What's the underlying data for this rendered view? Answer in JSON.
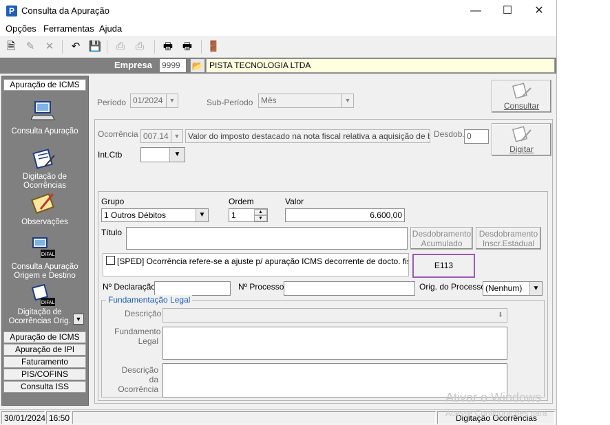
{
  "window": {
    "title": "Consulta da Apuração",
    "app_icon": "P"
  },
  "menu": [
    "Opções",
    "Ferramentas",
    "Ajuda"
  ],
  "empresa": {
    "label": "Empresa",
    "code": "9999",
    "name": "PISTA TECNOLOGIA LTDA"
  },
  "sidebar": {
    "active_tab": "Apuração de ICMS",
    "items": [
      {
        "label": "Consulta Apuração",
        "icon": "computer-icon"
      },
      {
        "label": "Digitação de Ocorrências",
        "icon": "notepad-icon"
      },
      {
        "label": "Observações",
        "icon": "notepad-pencil-icon"
      },
      {
        "label": "Consulta Apuração Origem e Destino",
        "icon": "difal-computer-icon"
      },
      {
        "label": "Digitação de Ocorrências Orig. De",
        "icon": "difal-notepad-icon"
      }
    ],
    "tabs": [
      "Apuração de ICMS ST",
      "Apuração de IPI",
      "Faturamento",
      "PIS/COFINS",
      "Consulta ISS"
    ]
  },
  "form": {
    "periodo_label": "Período",
    "periodo_value": "01/2024",
    "subperiodo_label": "Sub-Período",
    "subperiodo_value": "Mês",
    "consultar_label": "Consultar",
    "ocorrencia_label": "Ocorrência",
    "ocorrencia_code": "007.14",
    "ocorrencia_desc": "Valor do imposto destacado  na  nota fiscal  relativa  a aquisição de ben",
    "desdob_label": "Desdob.",
    "desdob_value": "0",
    "digitar_label": "Digitar",
    "intctb_label": "Int.Ctb",
    "grupo_label": "Grupo",
    "grupo_value": "1  Outros Débitos",
    "ordem_label": "Ordem",
    "ordem_value": "1",
    "valor_label": "Valor",
    "valor_value": "6.600,00",
    "titulo_label": "Título",
    "desdob_acum_label": "Desdobramento Acumulado",
    "desdob_inscr_label": "Desdobramento Inscr.Estadual",
    "sped_label": "[SPED] Ocorrência refere-se a ajuste p/ apuração ICMS decorrente de docto. fiscal na",
    "e113_label": "E113",
    "e113_border": "#9b59b6",
    "nro_declaracao_label": "Nº Declaração",
    "nro_processo_label": "Nº Processo",
    "orig_processo_label": "Orig. do Processo",
    "orig_processo_value": "(Nenhum)",
    "fundamentacao_legend": "Fundamentação Legal",
    "descricao_label": "Descrição",
    "fund_legal_label": "Fundamento Legal",
    "desc_ocorrencia_label": "Descrição da Ocorrência"
  },
  "status": {
    "date": "30/01/2024",
    "time": "16:50",
    "mode": "Digitação Ocorrências"
  },
  "watermark": {
    "line1": "Ativar o Windows",
    "line2": "Acesse Configurações para"
  }
}
